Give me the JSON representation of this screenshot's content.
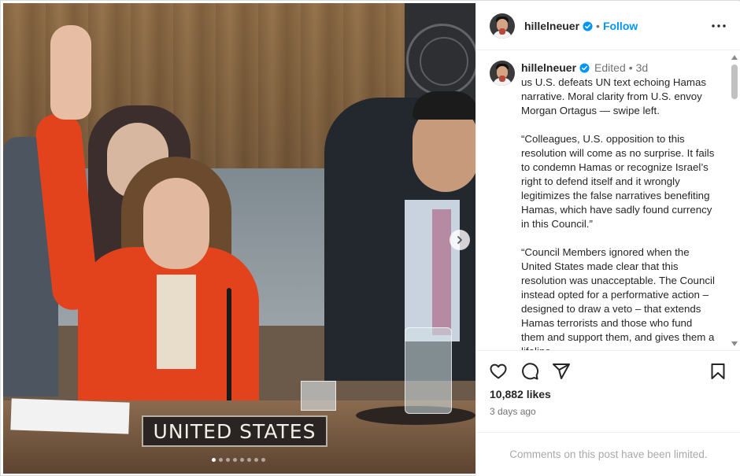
{
  "post": {
    "username": "hillelneuer",
    "follow_label": "Follow",
    "edited_label": "Edited",
    "time_ago": "3d",
    "caption_paragraphs": [
      "us U.S. defeats UN text echoing Hamas narrative. Moral clarity from U.S. envoy Morgan Ortagus — swipe left.",
      "“Colleagues, U.S. opposition to this resolution will come as no surprise. It fails to condemn Hamas or recognize Israel’s right to defend itself and it wrongly legitimizes the false narratives benefiting Hamas, which have sadly found currency in this Council.”",
      "“Council Members ignored when the United States made clear that this resolution was unacceptable. The Council instead opted for a performative action – designed to draw a veto – that extends Hamas terrorists and those who fund them and support them, and gives them a lifeline."
    ],
    "likes": "10,882 likes",
    "posted_ago": "3 days ago",
    "comments_limited": "Comments on this post have been limited."
  },
  "photo": {
    "nameplate": "UNITED STATES",
    "carousel_count": 8,
    "carousel_active": 0
  },
  "icons": {
    "verified": "verified-badge-icon",
    "more": "more-options-icon",
    "like": "heart-icon",
    "comment": "comment-icon",
    "share": "share-icon",
    "save": "bookmark-icon",
    "next": "chevron-right-icon"
  },
  "colors": {
    "accent": "#0095f6",
    "text": "#262626",
    "muted": "#737373"
  }
}
